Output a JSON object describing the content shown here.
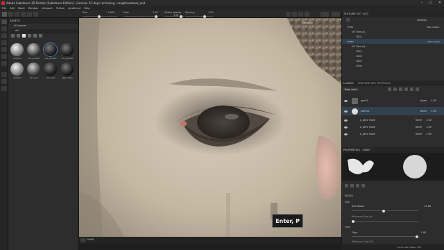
{
  "window": {
    "title": "Adobe Substance 3D Painter (Substance Edition) - License: 67 days remaining - roughnessbase_end",
    "controls": [
      "–",
      "□",
      "✕"
    ]
  },
  "menu": [
    "File",
    "Edit",
    "Mode",
    "Window",
    "Viewport",
    "Python",
    "JavaScript",
    "Help"
  ],
  "toolbar": {
    "size_label": "Size",
    "size_value": "1.600",
    "flow_label": "Flow",
    "flow_value": "1.00",
    "stroke_opacity_label": "Stroke opacity",
    "stroke_opacity_value": "1.00",
    "spacing_label": "Spacing",
    "spacing_value": "1.00"
  },
  "assets": {
    "title": "ASSETS",
    "library": "All libraries",
    "search": "dirt",
    "items": [
      {
        "label": "dirt_fine",
        "style": "light"
      },
      {
        "label": "dirt_spotted",
        "style": "spots"
      },
      {
        "label": "dirt_spotted",
        "style": "dark"
      },
      {
        "label": "dirt_spotted",
        "style": "dark"
      },
      {
        "label": "dirt_fine",
        "style": "light"
      },
      {
        "label": "dirt_spot",
        "style": "spots"
      },
      {
        "label": "dirt_spot",
        "style": "dark"
      },
      {
        "label": "Water Stain",
        "style": "dark"
      }
    ]
  },
  "viewport": {
    "camera_label": "Material",
    "mode_label": "MASK"
  },
  "texture_set_list": {
    "title": "TEXTURE SET LIST",
    "settings_label": "Settings",
    "sets": [
      {
        "name": "Eyes",
        "shader": "Main shader",
        "udims_label": "UV Tiles (1)",
        "udims": [
          "1001"
        ]
      },
      {
        "name": "head",
        "shader": "Main shader",
        "udims_label": "UV Tiles (4)",
        "udims": [
          "1001",
          "1002",
          "1003",
          "1004"
        ]
      }
    ]
  },
  "layers": {
    "tab1": "LAYERS",
    "tab2": "TEXTURE SET SETTINGS",
    "blend": "Base color",
    "rows": [
      {
        "name": "gen01",
        "blend": "Norm",
        "opacity": "1.00"
      },
      {
        "name": "paint01",
        "blend": "Norm",
        "opacity": "1.00"
      },
      {
        "name": "a_pt01 mask",
        "blend": "Norm",
        "opacity": "1.00"
      },
      {
        "name": "a_pt01 mask",
        "blend": "Norm",
        "opacity": "1.00"
      },
      {
        "name": "a_pt01 mask",
        "blend": "Norm",
        "opacity": "1.00"
      }
    ]
  },
  "properties": {
    "title": "PROPERTIES - PAINT",
    "brush_section": "BRUSH",
    "size_label": "Size",
    "size_value": "14.08",
    "size_space_label": "Size Space",
    "size_space_value": "Model",
    "min_size_label": "Minimum Size (%)",
    "min_size_value": "1.00",
    "flow_section": "Flow",
    "flow_label": "Flow",
    "flow_value": "1.00",
    "min_flow_label": "Minimum Flow (%)"
  },
  "status": "Cache Disk Usage: 56%",
  "tooltip": "Enter, P"
}
